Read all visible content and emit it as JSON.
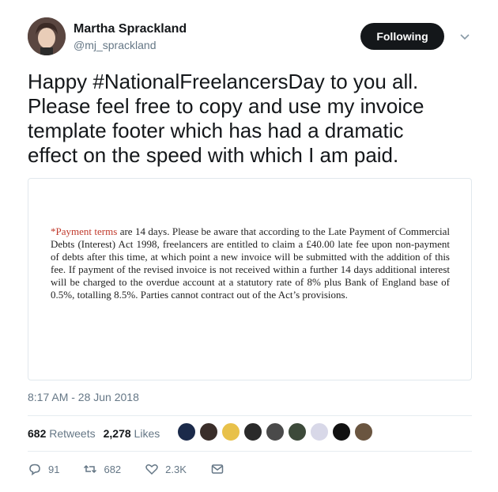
{
  "author": {
    "display_name": "Martha Sprackland",
    "handle": "@mj_sprackland"
  },
  "follow_button": {
    "label": "Following"
  },
  "tweet": {
    "text": "Happy #NationalFreelancersDay to you all.\nPlease feel free to copy and use my invoice\ntemplate footer which has had a dramatic\neffect on the speed with which I am paid."
  },
  "media": {
    "highlight": "*Payment terms",
    "body": " are 14 days. Please be aware that according to the Late Payment of Commercial Debts (Interest) Act 1998, freelancers are entitled to claim a £40.00 late fee upon non-payment of debts after this time, at which point a new invoice will be submitted with the addition of this fee. If payment of the revised invoice is not received within a further 14 days additional interest will be charged to the overdue account at a statutory rate of 8% plus Bank of England base of 0.5%, totalling 8.5%. Parties cannot contract out of the Act’s provisions."
  },
  "timestamp": "8:17 AM - 28 Jun 2018",
  "stats": {
    "retweets_count": "682",
    "retweets_label": "Retweets",
    "likes_count": "2,278",
    "likes_label": "Likes"
  },
  "likers": [
    "#1b2a4a",
    "#3a2e2a",
    "#e8c14a",
    "#2a2a2a",
    "#4a4a4a",
    "#3d4a3a",
    "#d8d8e8",
    "#111111",
    "#6a5540"
  ],
  "actions": {
    "replies": "91",
    "retweets": "682",
    "likes": "2.3K"
  },
  "colors": {
    "accent": "#1da1f2",
    "secondary_text": "#657786",
    "payment_terms_red": "#c0392b"
  }
}
